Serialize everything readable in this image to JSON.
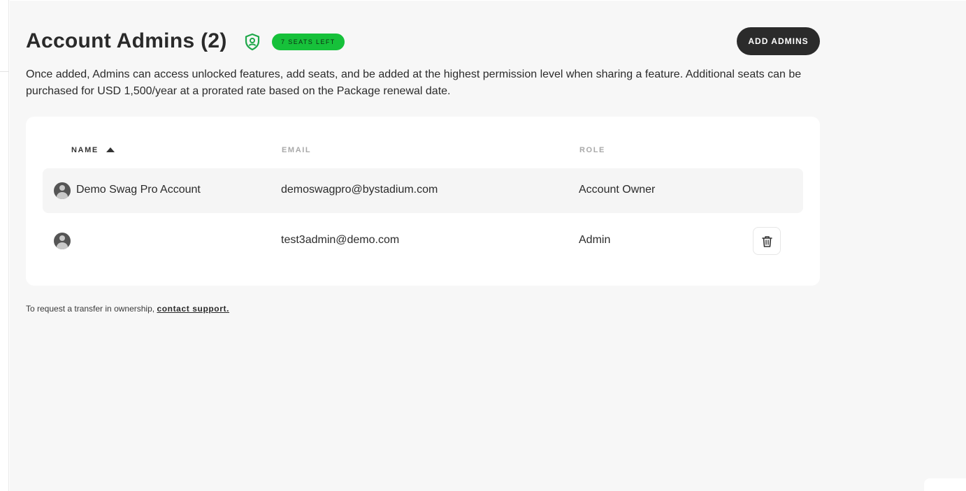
{
  "header": {
    "title": "Account Admins (2)",
    "seats_badge": "7 SEATS LEFT",
    "add_button": "ADD ADMINS"
  },
  "description": "Once added, Admins can access unlocked features, add seats, and be added at the highest permission level when sharing a feature. Additional seats can be purchased for USD 1,500/year at a prorated rate based on the Package renewal date.",
  "table": {
    "columns": [
      "NAME",
      "EMAIL",
      "ROLE"
    ],
    "rows": [
      {
        "name": "Demo Swag Pro Account",
        "email": "demoswagpro@bystadium.com",
        "role": "Account Owner"
      },
      {
        "name": "",
        "email": "test3admin@demo.com",
        "role": "Admin"
      }
    ]
  },
  "footer": {
    "text": "To request a transfer in ownership, ",
    "link": "contact support."
  },
  "colors": {
    "badge_green": "#16c13a",
    "button_dark": "#2b2b2b",
    "background": "#f7f7f7"
  }
}
